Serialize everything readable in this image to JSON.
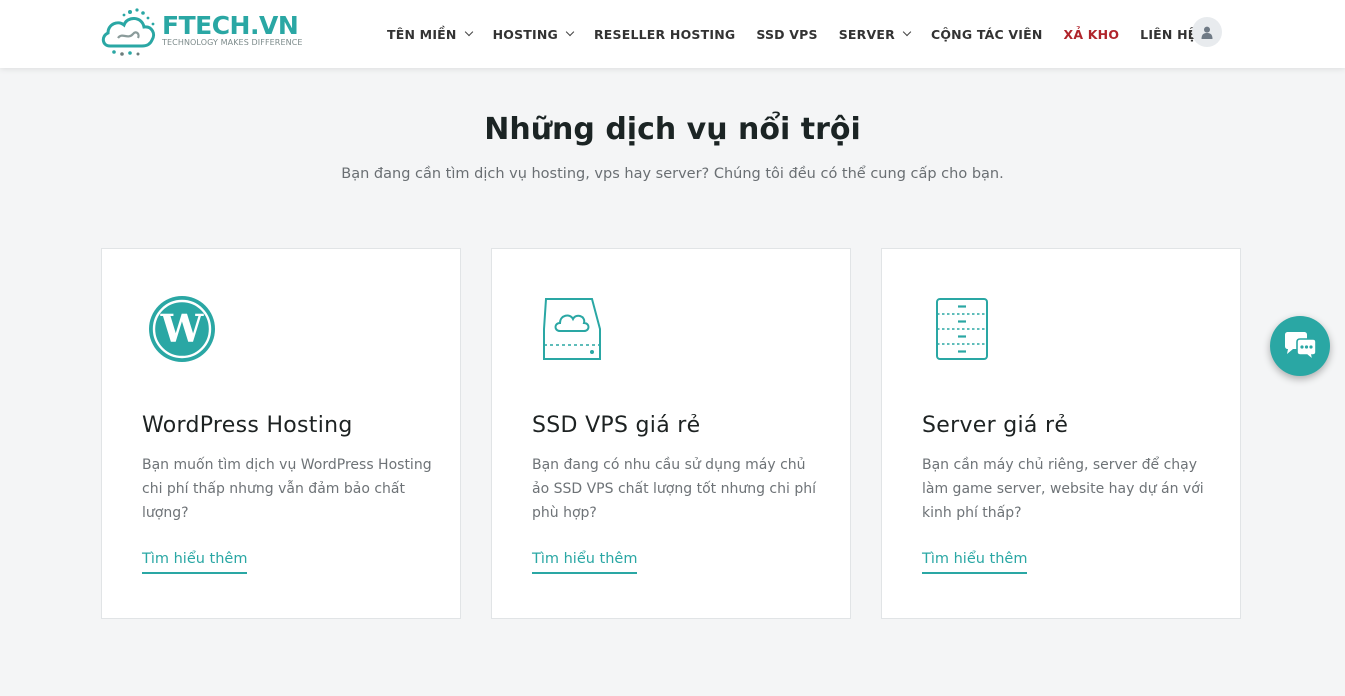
{
  "brand": {
    "name": "FTECH.VN",
    "tagline": "TECHNOLOGY MAKES DIFFERENCE",
    "color": "#2aa7a4"
  },
  "nav": {
    "items": [
      {
        "label": "TÊN MIỀN",
        "dropdown": true
      },
      {
        "label": "HOSTING",
        "dropdown": true
      },
      {
        "label": "RESELLER HOSTING",
        "dropdown": false
      },
      {
        "label": "SSD VPS",
        "dropdown": false
      },
      {
        "label": "SERVER",
        "dropdown": true
      },
      {
        "label": "CỘNG TÁC VIÊN",
        "dropdown": false
      },
      {
        "label": "XẢ KHO",
        "dropdown": false,
        "highlight": "#b0242b"
      },
      {
        "label": "LIÊN HỆ",
        "dropdown": false
      }
    ],
    "user_icon": "user-icon"
  },
  "section": {
    "title": "Những dịch vụ nổi trội",
    "subtitle": "Bạn đang cần tìm dịch vụ hosting, vps hay server? Chúng tôi đều có thể cung cấp cho bạn."
  },
  "cards": [
    {
      "icon": "wordpress-icon",
      "title": "WordPress Hosting",
      "description": "Bạn muốn tìm dịch vụ WordPress Hosting chi phí thấp nhưng vẫn đảm bảo chất lượng?",
      "link": "Tìm hiểu thêm"
    },
    {
      "icon": "cloud-drive-icon",
      "title": "SSD VPS giá rẻ",
      "description": "Bạn đang có nhu cầu sử dụng máy chủ ảo SSD VPS chất lượng tốt nhưng chi phí phù hợp?",
      "link": "Tìm hiểu thêm"
    },
    {
      "icon": "server-icon",
      "title": "Server giá rẻ",
      "description": "Bạn cần máy chủ riêng, server để chạy làm game server, website hay dự án với kinh phí thấp?",
      "link": "Tìm hiểu thêm"
    }
  ],
  "chat_widget": {
    "icon": "chat-bubbles-icon"
  }
}
